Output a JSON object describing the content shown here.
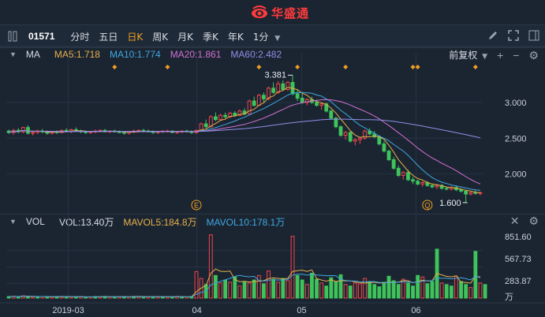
{
  "brand": {
    "name": "华盛通",
    "logo_icon": "brand-eye-logo-icon"
  },
  "toolbar": {
    "stock_code": "01571",
    "periods": [
      "分时",
      "五日",
      "日K",
      "周K",
      "月K",
      "季K",
      "年K",
      "1分"
    ],
    "active_period": "日K",
    "dropdown_icon": "caret-down-icon",
    "right_icons": [
      "pen-icon",
      "fullscreen-icon",
      "sidebar-toggle-icon"
    ]
  },
  "ma_panel": {
    "title": "MA",
    "ma5": "MA5:1.718",
    "ma10": "MA10:1.774",
    "ma20": "MA20:1.861",
    "ma60": "MA60:2.482",
    "adjust": "前复权",
    "colors": {
      "ma5": "#e6b04a",
      "ma10": "#3fa7e0",
      "ma20": "#d06fd0",
      "ma60": "#8f8fe6",
      "up": "#f2444b",
      "down": "#3ec45a"
    }
  },
  "vol_panel": {
    "title": "VOL",
    "vol": "VOL:13.40万",
    "mavol5": "MAVOL5:184.8万",
    "mavol10": "MAVOL10:178.1万"
  },
  "chart_data": [
    {
      "type": "candlestick",
      "y_ticks": [
        "3.000",
        "2.500",
        "2.000"
      ],
      "ylim": [
        1.5,
        3.55
      ],
      "high_label": "3.381",
      "low_label": "1.600",
      "markers": [
        "E",
        "Q"
      ],
      "ohlc": [
        [
          2.6,
          2.62,
          2.56,
          2.58
        ],
        [
          2.58,
          2.63,
          2.55,
          2.61
        ],
        [
          2.61,
          2.64,
          2.57,
          2.59
        ],
        [
          2.59,
          2.66,
          2.57,
          2.65
        ],
        [
          2.65,
          2.68,
          2.55,
          2.57
        ],
        [
          2.57,
          2.6,
          2.54,
          2.58
        ],
        [
          2.58,
          2.62,
          2.56,
          2.6
        ],
        [
          2.6,
          2.63,
          2.57,
          2.59
        ],
        [
          2.59,
          2.61,
          2.55,
          2.57
        ],
        [
          2.57,
          2.6,
          2.55,
          2.59
        ],
        [
          2.59,
          2.61,
          2.56,
          2.58
        ],
        [
          2.58,
          2.62,
          2.57,
          2.61
        ],
        [
          2.61,
          2.64,
          2.58,
          2.6
        ],
        [
          2.6,
          2.63,
          2.57,
          2.62
        ],
        [
          2.62,
          2.65,
          2.59,
          2.6
        ],
        [
          2.6,
          2.62,
          2.57,
          2.59
        ],
        [
          2.59,
          2.61,
          2.56,
          2.58
        ],
        [
          2.58,
          2.6,
          2.56,
          2.59
        ],
        [
          2.59,
          2.62,
          2.57,
          2.6
        ],
        [
          2.6,
          2.62,
          2.58,
          2.61
        ],
        [
          2.61,
          2.63,
          2.58,
          2.59
        ],
        [
          2.59,
          2.61,
          2.57,
          2.6
        ],
        [
          2.6,
          2.62,
          2.58,
          2.59
        ],
        [
          2.59,
          2.61,
          2.57,
          2.58
        ],
        [
          2.58,
          2.6,
          2.55,
          2.57
        ],
        [
          2.57,
          2.6,
          2.55,
          2.59
        ],
        [
          2.59,
          2.62,
          2.57,
          2.6
        ],
        [
          2.6,
          2.62,
          2.58,
          2.61
        ],
        [
          2.61,
          2.63,
          2.58,
          2.6
        ],
        [
          2.6,
          2.62,
          2.58,
          2.59
        ],
        [
          2.59,
          2.61,
          2.56,
          2.58
        ],
        [
          2.58,
          2.6,
          2.56,
          2.59
        ],
        [
          2.59,
          2.61,
          2.57,
          2.6
        ],
        [
          2.6,
          2.62,
          2.58,
          2.6
        ],
        [
          2.6,
          2.61,
          2.57,
          2.58
        ],
        [
          2.58,
          2.6,
          2.56,
          2.59
        ],
        [
          2.59,
          2.61,
          2.57,
          2.6
        ],
        [
          2.6,
          2.62,
          2.58,
          2.59
        ],
        [
          2.59,
          2.61,
          2.56,
          2.58
        ],
        [
          2.58,
          2.62,
          2.56,
          2.61
        ],
        [
          2.61,
          2.72,
          2.6,
          2.7
        ],
        [
          2.7,
          2.76,
          2.64,
          2.66
        ],
        [
          2.66,
          2.82,
          2.65,
          2.8
        ],
        [
          2.8,
          2.86,
          2.74,
          2.76
        ],
        [
          2.76,
          2.84,
          2.74,
          2.82
        ],
        [
          2.82,
          2.86,
          2.78,
          2.8
        ],
        [
          2.8,
          2.87,
          2.78,
          2.85
        ],
        [
          2.85,
          2.88,
          2.8,
          2.82
        ],
        [
          2.82,
          2.9,
          2.81,
          2.88
        ],
        [
          2.88,
          2.92,
          2.82,
          2.84
        ],
        [
          2.84,
          3.04,
          2.83,
          3.02
        ],
        [
          3.02,
          3.08,
          2.94,
          2.96
        ],
        [
          2.96,
          3.12,
          2.95,
          3.1
        ],
        [
          3.1,
          3.14,
          3.0,
          3.05
        ],
        [
          3.05,
          3.22,
          3.03,
          3.2
        ],
        [
          3.2,
          3.28,
          3.12,
          3.14
        ],
        [
          3.14,
          3.3,
          3.12,
          3.26
        ],
        [
          3.26,
          3.31,
          3.16,
          3.18
        ],
        [
          3.18,
          3.3,
          3.16,
          3.28
        ],
        [
          3.28,
          3.381,
          3.1,
          3.12
        ],
        [
          3.12,
          3.18,
          3.02,
          3.06
        ],
        [
          3.06,
          3.12,
          2.98,
          3.0
        ],
        [
          3.0,
          3.06,
          2.96,
          3.04
        ],
        [
          3.04,
          3.08,
          2.98,
          3.0
        ],
        [
          3.0,
          3.04,
          2.94,
          2.96
        ],
        [
          2.96,
          3.0,
          2.9,
          2.98
        ],
        [
          2.98,
          3.0,
          2.86,
          2.88
        ],
        [
          2.88,
          2.9,
          2.76,
          2.78
        ],
        [
          2.78,
          2.8,
          2.64,
          2.66
        ],
        [
          2.66,
          2.68,
          2.52,
          2.54
        ],
        [
          2.54,
          2.6,
          2.48,
          2.58
        ],
        [
          2.58,
          2.6,
          2.44,
          2.46
        ],
        [
          2.46,
          2.5,
          2.4,
          2.48
        ],
        [
          2.48,
          2.52,
          2.42,
          2.5
        ],
        [
          2.5,
          2.62,
          2.48,
          2.6
        ],
        [
          2.6,
          2.64,
          2.54,
          2.56
        ],
        [
          2.56,
          2.6,
          2.5,
          2.52
        ],
        [
          2.52,
          2.54,
          2.4,
          2.42
        ],
        [
          2.42,
          2.46,
          2.3,
          2.32
        ],
        [
          2.32,
          2.34,
          2.18,
          2.2
        ],
        [
          2.2,
          2.24,
          2.06,
          2.08
        ],
        [
          2.08,
          2.12,
          1.96,
          1.98
        ],
        [
          1.98,
          2.04,
          1.92,
          2.02
        ],
        [
          2.02,
          2.06,
          1.9,
          1.92
        ],
        [
          1.92,
          1.96,
          1.86,
          1.9
        ],
        [
          1.9,
          1.92,
          1.84,
          1.86
        ],
        [
          1.86,
          1.9,
          1.82,
          1.88
        ],
        [
          1.88,
          1.9,
          1.82,
          1.84
        ],
        [
          1.84,
          1.86,
          1.8,
          1.82
        ],
        [
          1.82,
          1.86,
          1.79,
          1.84
        ],
        [
          1.84,
          1.86,
          1.78,
          1.8
        ],
        [
          1.8,
          1.82,
          1.77,
          1.79
        ],
        [
          1.79,
          1.83,
          1.77,
          1.81
        ],
        [
          1.81,
          1.84,
          1.76,
          1.78
        ],
        [
          1.78,
          1.8,
          1.74,
          1.76
        ],
        [
          1.76,
          1.78,
          1.6,
          1.72
        ],
        [
          1.72,
          1.76,
          1.7,
          1.74
        ],
        [
          1.74,
          1.78,
          1.71,
          1.73
        ],
        [
          1.73,
          1.75,
          1.7,
          1.74
        ]
      ]
    },
    {
      "type": "bar",
      "y_ticks": [
        "851.60",
        "567.73",
        "283.87",
        "万"
      ],
      "ylim": [
        0,
        900
      ],
      "x_ticks": [
        "2019-03",
        "04",
        "05",
        "06"
      ],
      "values": [
        20,
        24,
        18,
        30,
        22,
        16,
        18,
        20,
        14,
        16,
        18,
        22,
        20,
        16,
        14,
        18,
        12,
        16,
        20,
        18,
        22,
        16,
        14,
        18,
        20,
        16,
        22,
        24,
        18,
        16,
        14,
        20,
        18,
        16,
        14,
        22,
        18,
        16,
        20,
        350,
        260,
        180,
        840,
        300,
        200,
        240,
        210,
        280,
        160,
        220,
        200,
        240,
        300,
        190,
        360,
        250,
        210,
        260,
        230,
        820,
        300,
        240,
        180,
        330,
        250,
        200,
        160,
        270,
        220,
        310,
        180,
        160,
        200,
        190,
        260,
        220,
        180,
        150,
        210,
        290,
        230,
        180,
        250,
        200,
        160,
        300,
        280,
        190,
        220,
        650,
        200,
        180,
        160,
        290,
        220,
        180,
        140,
        620,
        200,
        180
      ],
      "up": [
        0,
        1,
        0,
        1,
        0,
        1,
        0,
        1,
        0,
        1,
        0,
        1,
        0,
        1,
        0,
        1,
        0,
        1,
        0,
        1,
        0,
        1,
        0,
        1,
        0,
        1,
        0,
        1,
        0,
        1,
        0,
        1,
        0,
        1,
        0,
        1,
        0,
        1,
        0,
        1,
        1,
        0,
        1,
        0,
        1,
        0,
        1,
        0,
        1,
        0,
        1,
        0,
        1,
        0,
        1,
        0,
        1,
        0,
        1,
        1,
        0,
        0,
        1,
        0,
        0,
        1,
        0,
        0,
        0,
        0,
        1,
        0,
        1,
        1,
        1,
        0,
        0,
        0,
        0,
        0,
        0,
        0,
        1,
        0,
        0,
        0,
        1,
        0,
        0,
        0,
        1,
        0,
        0,
        1,
        0,
        0,
        1,
        0,
        1,
        0
      ]
    }
  ]
}
